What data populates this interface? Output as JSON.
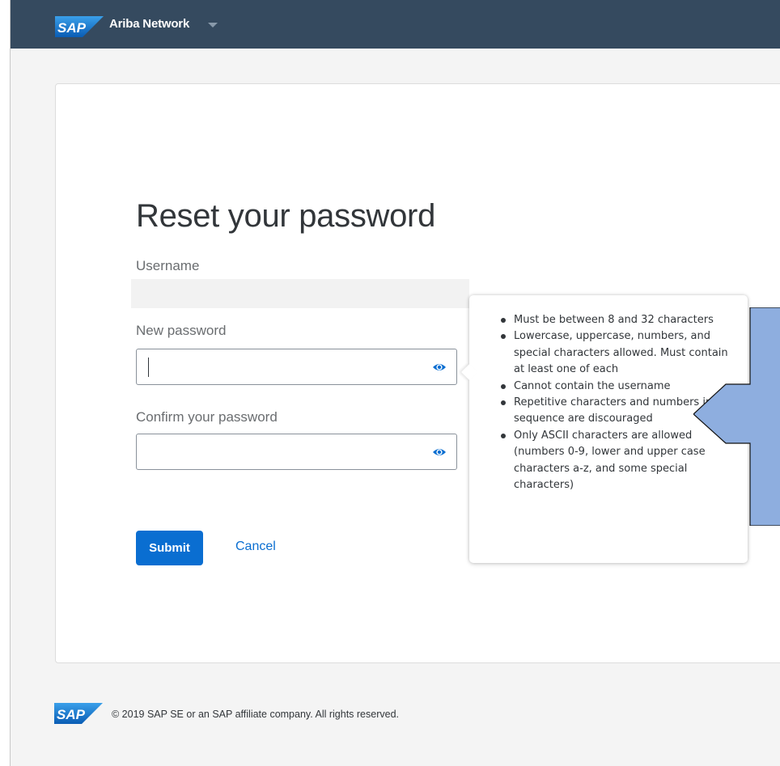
{
  "header": {
    "logo_text": "SAP",
    "brand": "Ariba Network"
  },
  "form": {
    "title": "Reset your password",
    "username_label": "Username",
    "username_value": "",
    "new_password_label": "New password",
    "new_password_value": "",
    "confirm_password_label": "Confirm your password",
    "confirm_password_value": "",
    "submit_label": "Submit",
    "cancel_label": "Cancel"
  },
  "password_rules": {
    "items": [
      "Must be between 8 and 32 characters",
      "Lowercase, uppercase, numbers, and special characters allowed. Must contain at least one of each",
      "Cannot contain the username",
      "Repetitive characters and numbers in sequence are discouraged",
      "Only ASCII characters are allowed (numbers 0-9, lower and upper case characters a-z, and some special characters)"
    ]
  },
  "footer": {
    "logo_text": "SAP",
    "copyright": "© 2019 SAP SE or an SAP affiliate company. All rights reserved."
  },
  "icons": {
    "show_password": "eye-icon",
    "brand_menu": "chevron-down-icon"
  },
  "colors": {
    "topbar": "#354a5f",
    "primary": "#0a6ed1",
    "sap_blue": "#1f78c8",
    "callout_fill": "#8eaedf",
    "callout_stroke": "#111111"
  }
}
